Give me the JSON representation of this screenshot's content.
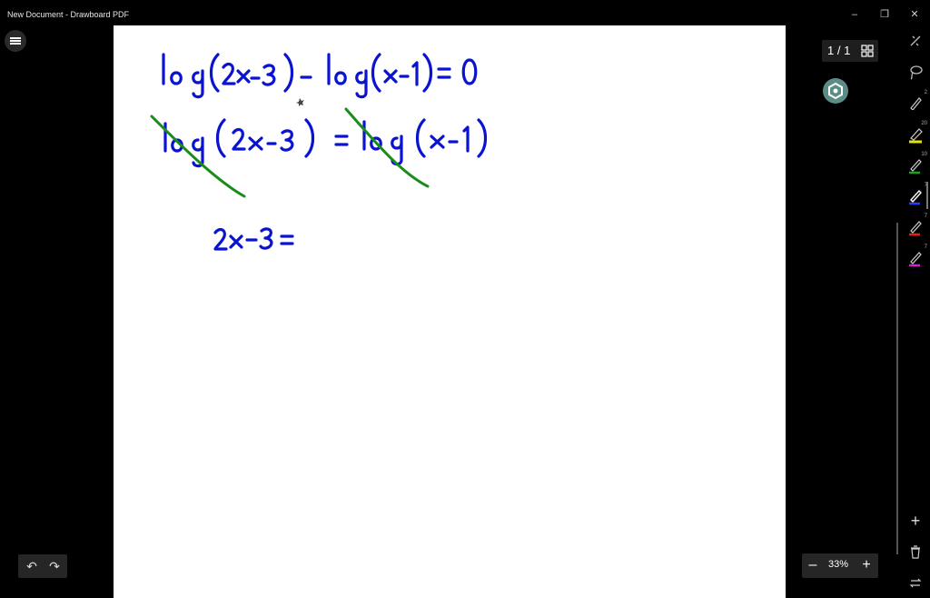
{
  "window": {
    "title": "New Document - Drawboard PDF",
    "minimize": "–",
    "restore": "❐",
    "close": "✕"
  },
  "document": {
    "handwriting": [
      "log(2x-3) - log(x-1) = 0",
      "log (2x-3) = log (x-1)",
      "2x-3 ="
    ],
    "ink_color": "#0a14d0",
    "strike_color": "#1a8c1a"
  },
  "page_indicator": {
    "text": "1 / 1"
  },
  "undo": {
    "undo_glyph": "↶",
    "redo_glyph": "↷"
  },
  "zoom": {
    "minus": "–",
    "value": "33%",
    "plus": "+"
  },
  "toolbar": {
    "tools": [
      {
        "name": "ruler-icon",
        "num": ""
      },
      {
        "name": "lasso-icon",
        "num": ""
      },
      {
        "name": "pen-black-icon",
        "num": "2"
      },
      {
        "name": "highlighter-yellow-icon",
        "num": "20"
      },
      {
        "name": "pen-green-icon",
        "num": "10"
      },
      {
        "name": "pen-blue-icon",
        "num": "7"
      },
      {
        "name": "pen-red-icon",
        "num": "7"
      },
      {
        "name": "pen-magenta-icon",
        "num": "7"
      }
    ],
    "add": "+"
  }
}
